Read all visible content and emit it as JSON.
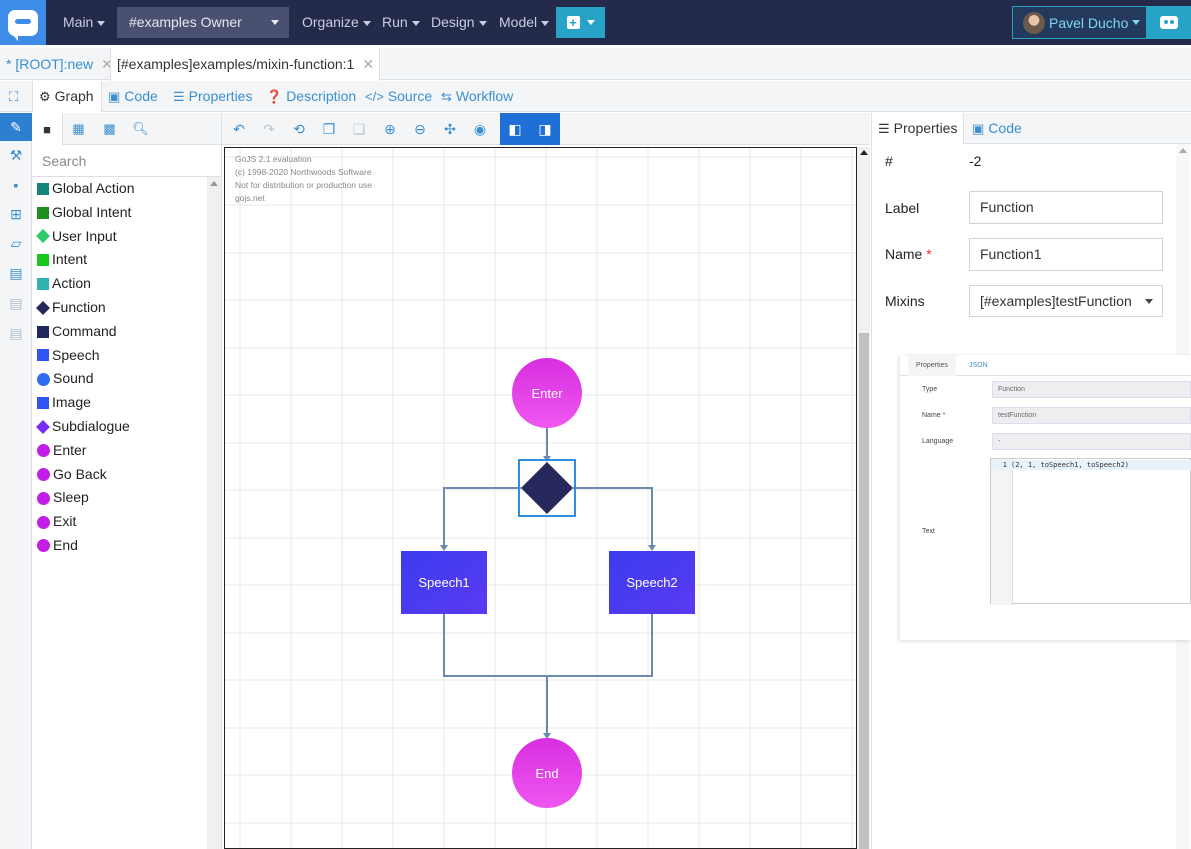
{
  "topbar": {
    "nav": [
      "Main",
      "Organize",
      "Run",
      "Design",
      "Model"
    ],
    "owner": "#examples Owner",
    "user": "Pavel Ducho"
  },
  "tabs": {
    "root": "* [ROOT]:new",
    "current": "[#examples]examples/mixin-function:1"
  },
  "toolbar": {
    "graph": "Graph",
    "code": "Code",
    "properties": "Properties",
    "description": "Description",
    "source": "Source",
    "workflow": "Workflow"
  },
  "palette": {
    "search_placeholder": "Search",
    "items": [
      {
        "label": "Global Action",
        "color": "#16857a",
        "shape": "square"
      },
      {
        "label": "Global Intent",
        "color": "#1e8f1e",
        "shape": "square"
      },
      {
        "label": "User Input",
        "color": "#2ec96a",
        "shape": "diamond"
      },
      {
        "label": "Intent",
        "color": "#19c71e",
        "shape": "square"
      },
      {
        "label": "Action",
        "color": "#2fb3b0",
        "shape": "square"
      },
      {
        "label": "Function",
        "color": "#26285c",
        "shape": "diamond"
      },
      {
        "label": "Command",
        "color": "#22285e",
        "shape": "square"
      },
      {
        "label": "Speech",
        "color": "#3153f0",
        "shape": "square"
      },
      {
        "label": "Sound",
        "color": "#2f6df0",
        "shape": "circle"
      },
      {
        "label": "Image",
        "color": "#3153f0",
        "shape": "square"
      },
      {
        "label": "Subdialogue",
        "color": "#7a2cf2",
        "shape": "diamond"
      },
      {
        "label": "Enter",
        "color": "#c21ee6",
        "shape": "circle"
      },
      {
        "label": "Go Back",
        "color": "#c21ee6",
        "shape": "circle"
      },
      {
        "label": "Sleep",
        "color": "#c21ee6",
        "shape": "circle"
      },
      {
        "label": "Exit",
        "color": "#c21ee6",
        "shape": "circle"
      },
      {
        "label": "End",
        "color": "#c21ee6",
        "shape": "circle"
      }
    ]
  },
  "diagram": {
    "watermark": [
      "GoJS 2.1 evaluation",
      "(c) 1998-2020 Northwoods Software",
      "Not for distribution or production use",
      "gojs.net"
    ],
    "nodes": {
      "enter": "Enter",
      "speech1": "Speech1",
      "speech2": "Speech2",
      "end": "End"
    }
  },
  "properties": {
    "tab_properties": "Properties",
    "tab_code": "Code",
    "id_label": "#",
    "id_value": "-2",
    "label_label": "Label",
    "label_value": "Function",
    "name_label": "Name",
    "name_value": "Function1",
    "mixins_label": "Mixins",
    "mixins_value": "[#examples]testFunction"
  },
  "popup": {
    "tab_properties": "Properties",
    "tab_json": "JSON",
    "type_label": "Type",
    "type_value": "Function",
    "name_label": "Name",
    "name_value": "testFunction",
    "language_label": "Language",
    "language_value": "-",
    "text_label": "Text",
    "code_line_number": "1",
    "code": "(2, 1, toSpeech1, toSpeech2)"
  },
  "colors": {
    "topbar": "#232a4a",
    "accent": "#26a3c6",
    "link": "#3b8fd0",
    "selection": "#2f8ee0"
  }
}
